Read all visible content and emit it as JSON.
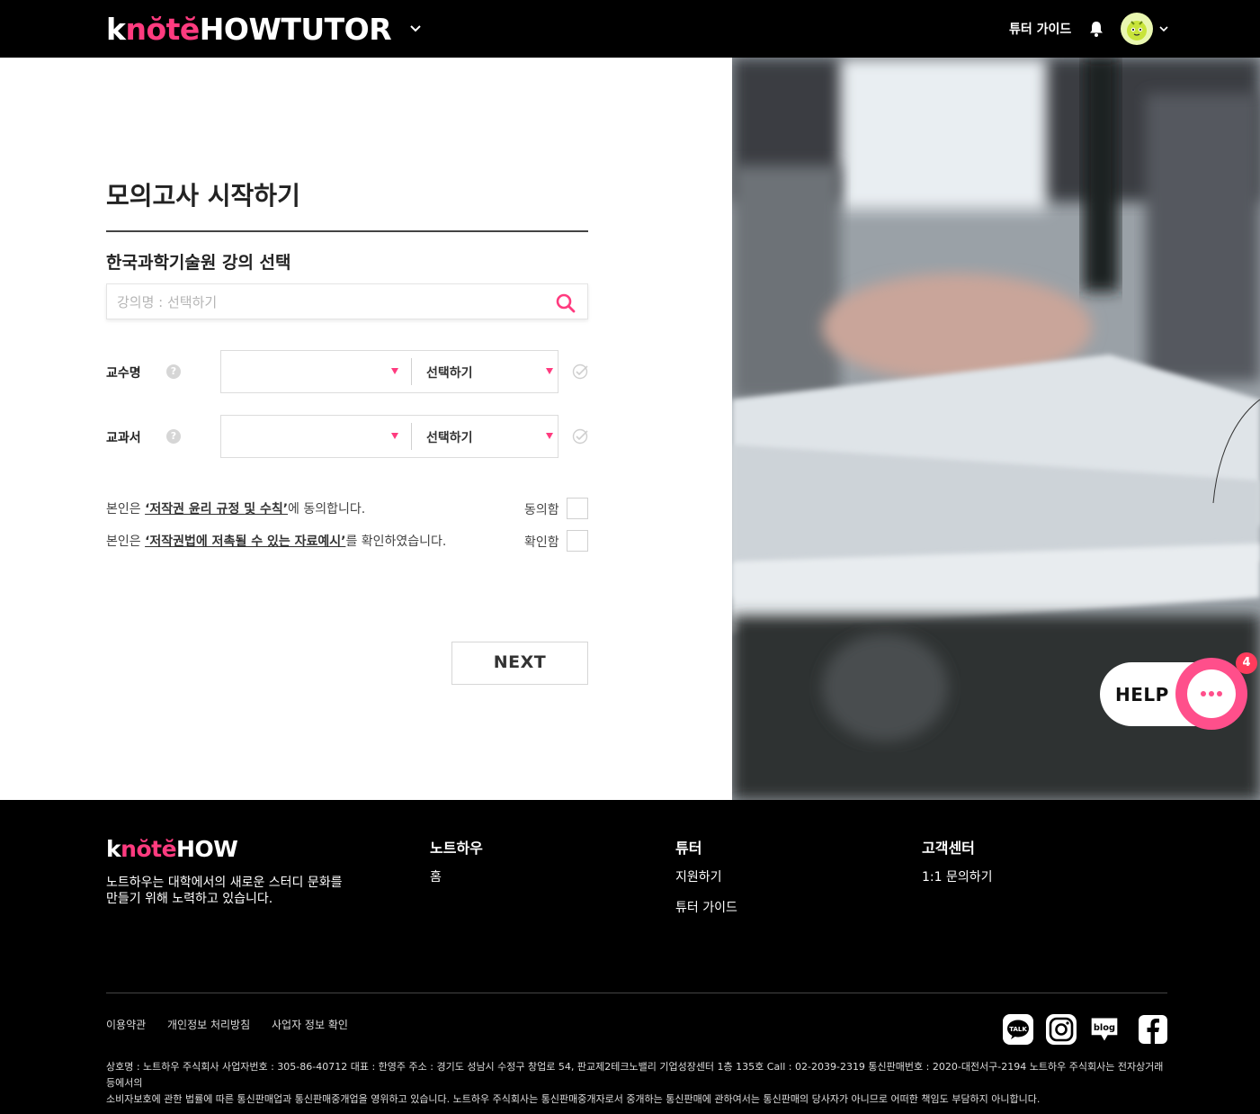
{
  "header": {
    "logo": {
      "k": "k",
      "note": "nŏtĕ",
      "how": "HOW",
      "suffix": " TUTOR"
    },
    "guide_label": "튜터 가이드"
  },
  "main": {
    "title": "모의고사 시작하기",
    "section_title": "한국과학기술원 강의 선택",
    "search": {
      "placeholder": "강의명 : 선택하기",
      "value": ""
    },
    "fields": [
      {
        "label": "교수명",
        "help": "?",
        "select_a": "",
        "select_b": "선택하기"
      },
      {
        "label": "교과서",
        "help": "?",
        "select_a": "",
        "select_b": "선택하기"
      }
    ],
    "agreements": [
      {
        "prefix": "본인은 ",
        "link": "‘저작권 윤리 규정 및 수칙’",
        "suffix": "에 동의합니다.",
        "check_label": "동의함",
        "checked": false
      },
      {
        "prefix": "본인은 ",
        "link": "‘저작권법에 저촉될 수 있는 자료예시’",
        "suffix": "를 확인하였습니다.",
        "check_label": "확인함",
        "checked": false
      }
    ],
    "next_label": "NEXT"
  },
  "help_widget": {
    "label": "HELP",
    "badge": "4"
  },
  "footer": {
    "logo": {
      "k": "k",
      "note": "nŏtĕ",
      "how": "HOW"
    },
    "description": "노트하우는 대학에서의 새로운 스터디 문화를\n만들기 위해 노력하고 있습니다.",
    "columns": [
      {
        "title": "노트하우",
        "links": [
          "홈"
        ]
      },
      {
        "title": "튜터",
        "links": [
          "지원하기",
          "튜터 가이드"
        ]
      },
      {
        "title": "고객센터",
        "links": [
          "1:1 문의하기"
        ]
      }
    ],
    "policy_links": [
      "이용약관",
      "개인정보 처리방침",
      "사업자 정보 확인"
    ],
    "social": [
      "kakao-talk-icon",
      "instagram-icon",
      "blog-icon",
      "facebook-icon"
    ],
    "legal_line1": "상호명 : 노트하우 주식회사 사업자번호 : 305-86-40712 대표 : 한영주 주소 : 경기도 성남시 수정구 창업로 54, 판교제2테크노밸리 기업성장센터 1층 135호 Call : 02-2039-2319 통신판매번호 : 2020-대전서구-2194 노트하우 주식회사는 전자상거래 등에서의",
    "legal_line2": "소비자보호에 관한 법률에 따른 통신판매업과 통신판매중개업을 영위하고 있습니다. 노트하우 주식회사는 통신판매중개자로서 중개하는 통신판매에 관하여서는 통신판매의 당사자가 아니므로 어떠한 책임도 부담하지 아니합니다."
  },
  "colors": {
    "accent": "#ff3b7f",
    "header_bg": "#000000",
    "footer_bg": "#000000"
  }
}
